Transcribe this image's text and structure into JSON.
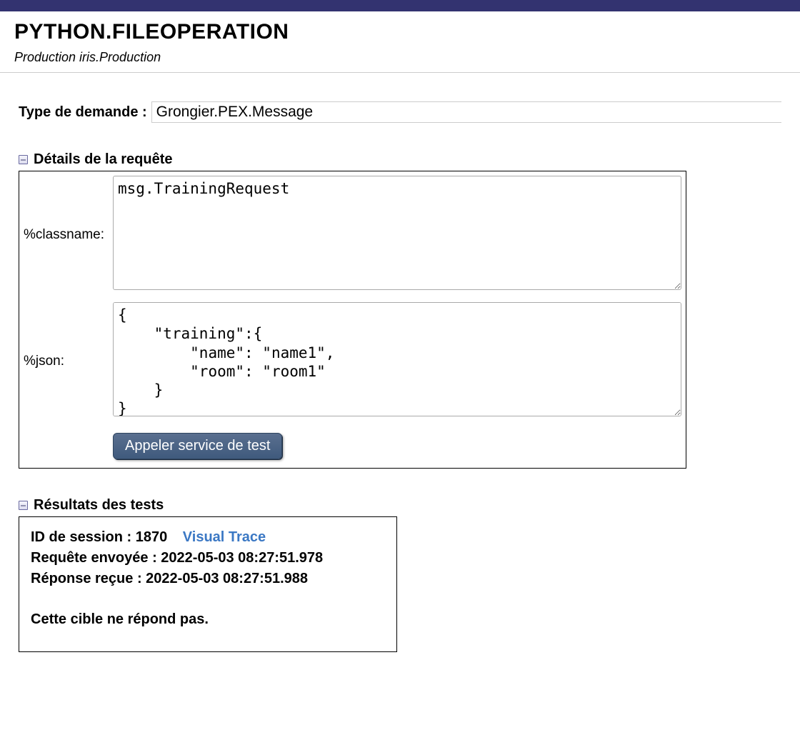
{
  "header": {
    "title": "PYTHON.FILEOPERATION",
    "subtitle": "Production iris.Production"
  },
  "request_type": {
    "label": "Type de demande :",
    "value": "Grongier.PEX.Message"
  },
  "details": {
    "heading": "Détails de la requête",
    "classname_label": "%classname:",
    "classname_value": "msg.TrainingRequest",
    "json_label": "%json:",
    "json_value": "{\n    \"training\":{\n        \"name\": \"name1\",\n        \"room\": \"room1\"\n    }\n}",
    "call_button": "Appeler service de test"
  },
  "results": {
    "heading": "Résultats des tests",
    "session_label": "ID de session :",
    "session_id": "1870",
    "visual_trace": "Visual Trace",
    "request_sent_label": "Requête envoyée :",
    "request_sent_ts": "2022-05-03 08:27:51.978",
    "response_recv_label": "Réponse reçue :",
    "response_recv_ts": "2022-05-03 08:27:51.988",
    "note": "Cette cible ne répond pas."
  }
}
